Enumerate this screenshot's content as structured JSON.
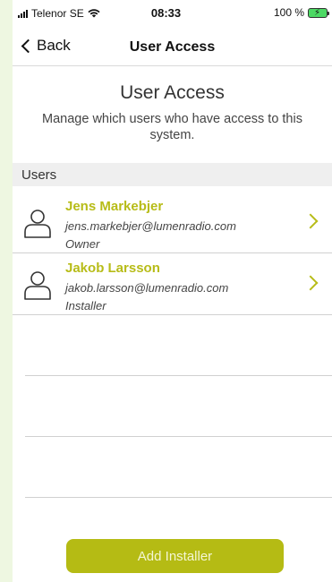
{
  "status_bar": {
    "carrier": "Telenor SE",
    "time": "08:33",
    "battery": "100 %",
    "battery_color": "#4cd964"
  },
  "nav": {
    "back_label": "Back",
    "title": "User Access"
  },
  "header": {
    "title": "User Access",
    "subtitle": "Manage which users who have access to this system."
  },
  "users_section": {
    "label": "Users",
    "items": [
      {
        "name": "Jens Markebjer",
        "email": "jens.markebjer@lumenradio.com",
        "role": "Owner",
        "icon": "user-icon"
      },
      {
        "name": "Jakob Larsson",
        "email": "jakob.larsson@lumenradio.com",
        "role": "Installer",
        "icon": "user-icon"
      }
    ]
  },
  "actions": {
    "add_installer_label": "Add Installer"
  },
  "colors": {
    "accent": "#b7bc18",
    "button": "#b5bb14",
    "background_side": "#eef7e1"
  }
}
